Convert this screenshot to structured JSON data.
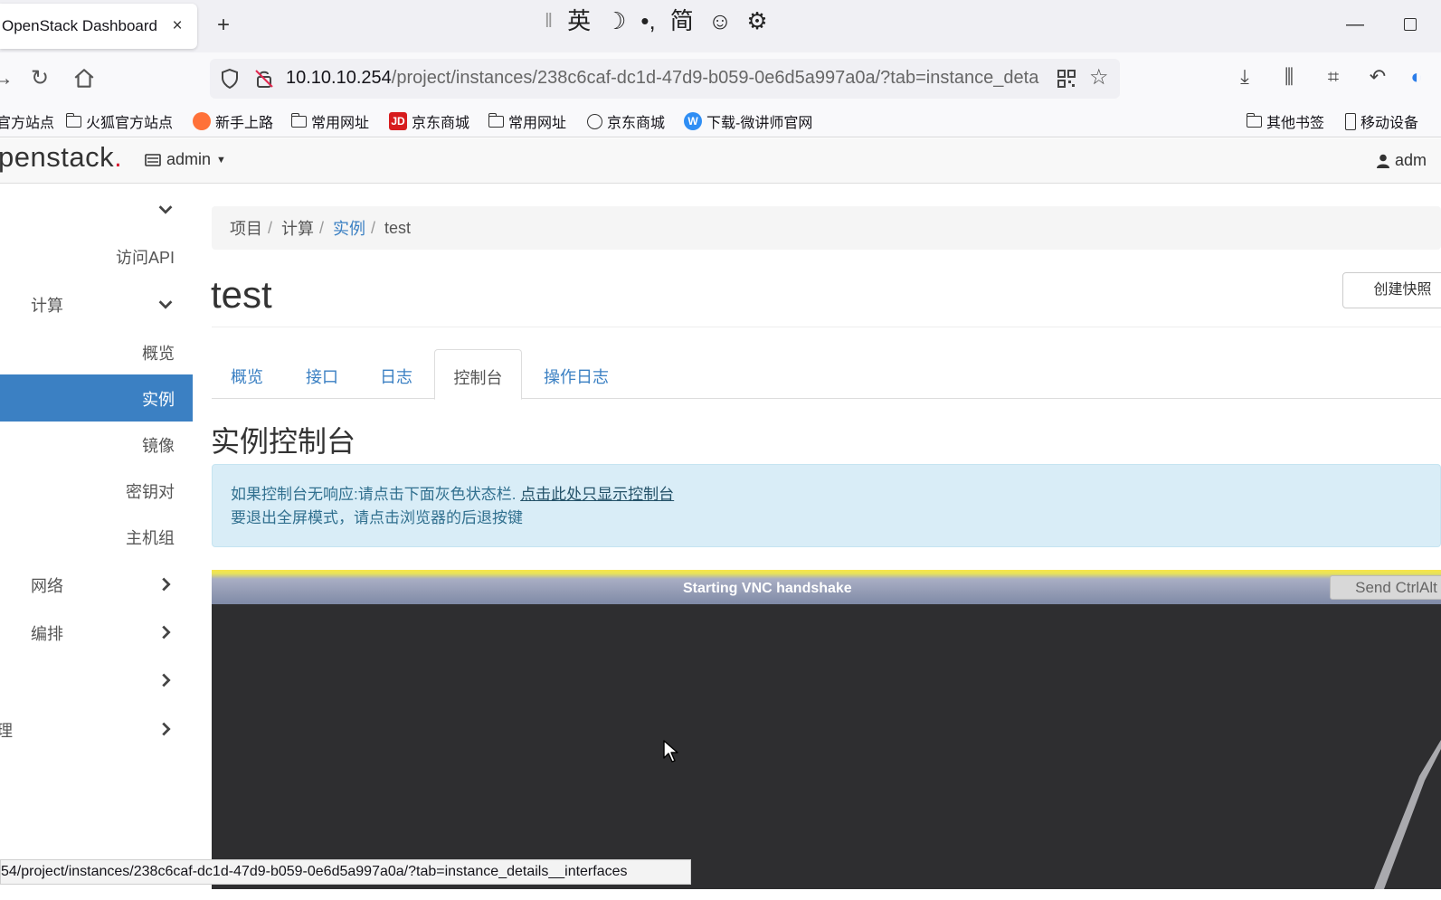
{
  "browser": {
    "tab_title": "OpenStack Dashboard",
    "tab_close": "×",
    "new_tab": "+",
    "ime": {
      "lang": "英",
      "punct": "•,",
      "script": "简"
    },
    "url_host": "10.10.10.254",
    "url_path": "/project/instances/238c6caf-dc1d-47d9-b059-0e6d5a997a0a/?tab=instance_deta",
    "bookmarks": [
      {
        "label": "官方站点"
      },
      {
        "label": "火狐官方站点"
      },
      {
        "label": "新手上路"
      },
      {
        "label": "常用网址"
      },
      {
        "label": "京东商城",
        "badge": "JD"
      },
      {
        "label": "常用网址"
      },
      {
        "label": "京东商城"
      },
      {
        "label": "下载-微讲师官网",
        "badge": "W"
      },
      {
        "label": "其他书签"
      },
      {
        "label": "移动设备"
      }
    ],
    "status_url": "54/project/instances/238c6caf-dc1d-47d9-b059-0e6d5a997a0a/?tab=instance_details__interfaces"
  },
  "header": {
    "logo_text": "penstack",
    "logo_dot": ".",
    "project": "admin",
    "user": "adm"
  },
  "sidebar": {
    "items": [
      {
        "label": ""
      },
      {
        "label": "访问API"
      },
      {
        "label": "计算"
      },
      {
        "label": "概览"
      },
      {
        "label": "实例"
      },
      {
        "label": "镜像"
      },
      {
        "label": "密钥对"
      },
      {
        "label": "主机组"
      },
      {
        "label": "网络"
      },
      {
        "label": "编排"
      },
      {
        "label": ""
      },
      {
        "label": "理"
      }
    ]
  },
  "breadcrumb": {
    "items": [
      "项目",
      "计算",
      "实例",
      "test"
    ],
    "sep": "/"
  },
  "page": {
    "title": "test",
    "create_snapshot": "创建快照",
    "tabs": [
      "概览",
      "接口",
      "日志",
      "控制台",
      "操作日志"
    ],
    "section_title": "实例控制台",
    "alert_line1": "如果控制台无响应:请点击下面灰色状态栏.",
    "alert_link": "点击此处只显示控制台",
    "alert_line2": "要退出全屏模式，请点击浏览器的后退按键"
  },
  "vnc": {
    "status": "Starting VNC handshake",
    "send_ctrl_alt_del": "Send CtrlAlt"
  },
  "colors": {
    "accent": "#3b80c3",
    "alert_bg": "#d9edf7",
    "vnc_bg": "#2e2e30"
  }
}
